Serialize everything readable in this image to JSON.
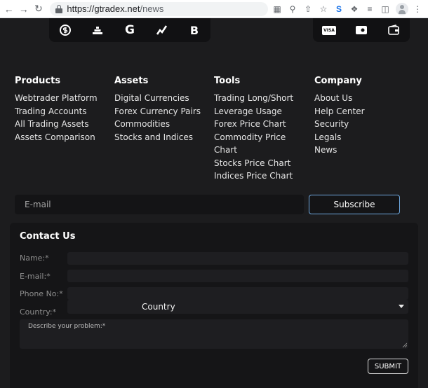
{
  "browser": {
    "url_host": "https://gtradex.net",
    "url_path": "/news"
  },
  "icon_bar_left": [
    "dollar-coin-icon",
    "stacked-bars-icon",
    "letter-g-icon",
    "stock-chart-icon",
    "bitcoin-icon"
  ],
  "icon_bar_right": [
    "visa-card-icon",
    "card-icon",
    "wallet-icon"
  ],
  "visa_text": "VISA",
  "letter_g": "G",
  "bitcoin_symbol": "B",
  "footer": {
    "products": {
      "title": "Products",
      "links": [
        "Webtrader Platform",
        "Trading Accounts",
        "All Trading Assets",
        "Assets Comparison"
      ]
    },
    "assets": {
      "title": "Assets",
      "links": [
        "Digital Currencies",
        "Forex Currency Pairs",
        "Commodities",
        "Stocks and Indices"
      ]
    },
    "tools": {
      "title": "Tools",
      "links": [
        "Trading Long/Short",
        "Leverage Usage",
        "Forex Price Chart",
        "Commodity Price",
        "Chart",
        "Stocks Price Chart",
        "Indices Price Chart"
      ]
    },
    "company": {
      "title": "Company",
      "links": [
        "About Us",
        "Help Center",
        "Security",
        "Legals",
        "News"
      ]
    }
  },
  "subscribe": {
    "placeholder": "E-mail",
    "button": "Subscribe"
  },
  "contact": {
    "title": "Contact Us",
    "name_label": "Name:*",
    "email_label": "E-mail:*",
    "phone_label": "Phone No:*",
    "country_label": "Country:*",
    "country_selected": "Country",
    "problem_label": "Describe your problem:*",
    "submit": "SUBMIT"
  },
  "colors": {
    "background": "#1c1c1e",
    "panel": "#151517",
    "subscribe_border": "#6fa9e0"
  }
}
